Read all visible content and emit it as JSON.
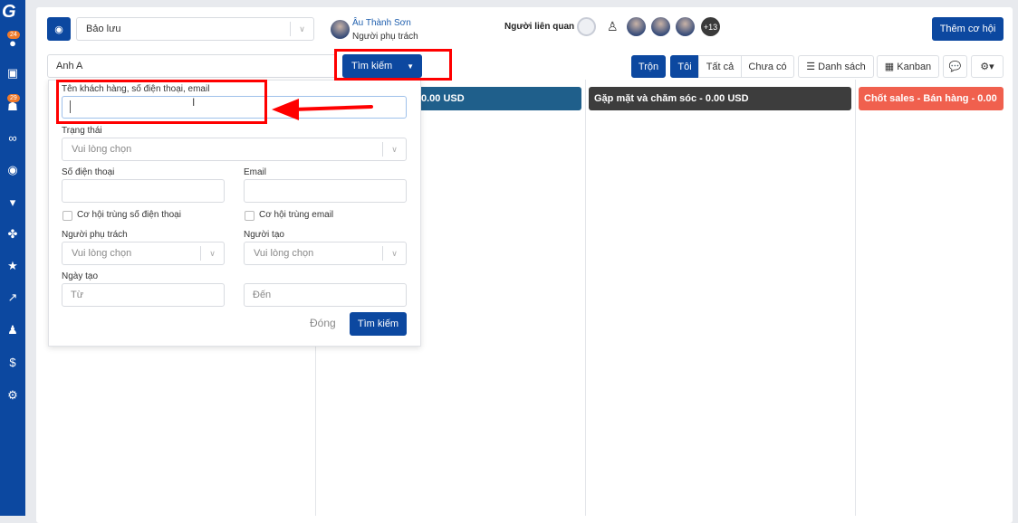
{
  "sidebar": {
    "logo": "G",
    "badges": [
      "24",
      "29"
    ],
    "icons": [
      "user-icon",
      "briefcase-icon",
      "users-icon",
      "handshake-icon",
      "target-icon",
      "cart-icon",
      "cubes-icon",
      "star-icon",
      "chart-line-icon",
      "user-tie-icon",
      "dollar-icon",
      "gear-icon"
    ]
  },
  "header": {
    "pipeline_select": "Bảo lưu",
    "owner_name": "Âu Thành Sơn",
    "owner_role": "Người phụ trách",
    "related_label": "Người liên quan",
    "more_count": "+13",
    "add_button": "Thêm cơ hội"
  },
  "toolbar": {
    "search_value": "Anh A",
    "search_button": "Tìm kiếm",
    "filters": [
      "Trộn",
      "Tôi",
      "Tất cả",
      "Chưa có"
    ],
    "list_view": "Danh sách",
    "kanban_view": "Kanban"
  },
  "columns": [
    {
      "title": "0.00 USD",
      "color": "#1f5f8b"
    },
    {
      "title": "Gặp mặt và chăm sóc -  0.00 USD",
      "color": "#3d3d3d"
    },
    {
      "title": "Chốt sales - Bán hàng -  0.00",
      "color": "#f0604e"
    }
  ],
  "search_panel": {
    "keyword_label": "Tên khách hàng, số điện thoại, email",
    "keyword_value": "",
    "status_label": "Trạng thái",
    "status_placeholder": "Vui lòng chọn",
    "phone_label": "Số điện thoại",
    "email_label": "Email",
    "dup_phone": "Cơ hội trùng số điện thoại",
    "dup_email": "Cơ hội trùng email",
    "owner_label": "Người phụ trách",
    "owner_placeholder": "Vui lòng chọn",
    "creator_label": "Người tạo",
    "creator_placeholder": "Vui lòng chọn",
    "created_label": "Ngày tạo",
    "from_placeholder": "Từ",
    "to_placeholder": "Đến",
    "close_button": "Đóng",
    "search_button": "Tìm kiếm"
  },
  "annotation_color": "#ff0000"
}
